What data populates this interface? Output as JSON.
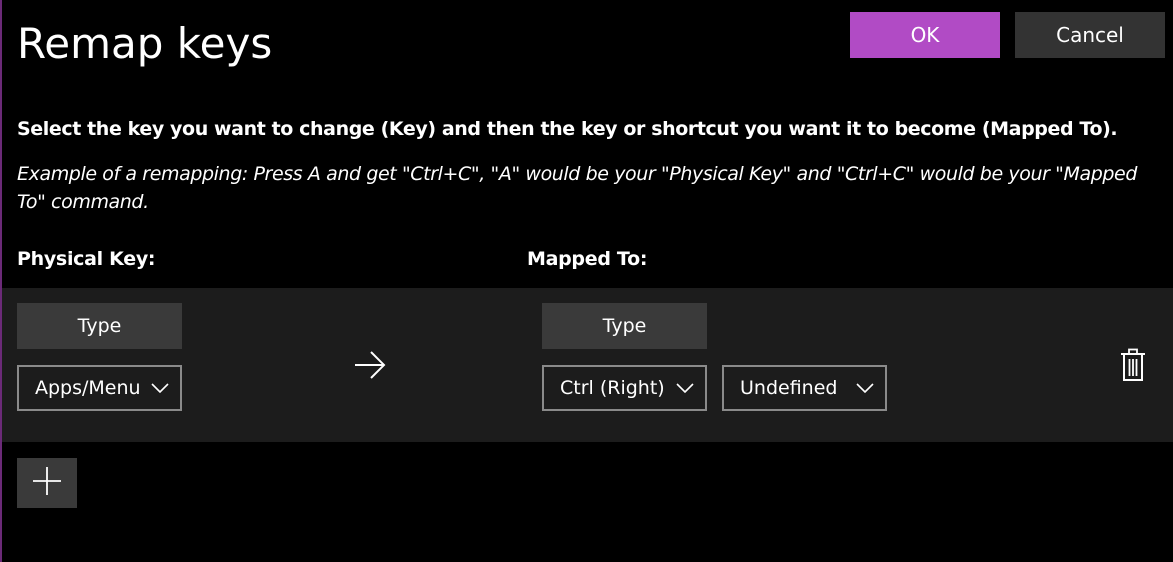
{
  "window": {
    "title": "Remap keys"
  },
  "actions": {
    "ok_label": "OK",
    "cancel_label": "Cancel"
  },
  "colors": {
    "accent": "#b14bc5",
    "background": "#000000",
    "row_background": "#1c1c1c",
    "button_background": "#3a3a3a"
  },
  "description": {
    "instruction": "Select the key you want to change (Key) and then the key or shortcut you want it to become (Mapped To).",
    "example": "Example of a remapping: Press A and get \"Ctrl+C\", \"A\" would be your \"Physical Key\" and \"Ctrl+C\" would be your \"Mapped To\" command."
  },
  "columns": {
    "physical_key": "Physical Key:",
    "mapped_to": "Mapped To:"
  },
  "remap_rows": [
    {
      "physical": {
        "type_label": "Type",
        "selected_key": "Apps/Menu"
      },
      "arrow_icon": "arrow-right-icon",
      "mapped": {
        "type_label": "Type",
        "selected_keys": [
          "Ctrl (Right)",
          "Undefined"
        ]
      },
      "delete_icon": "trash-icon"
    }
  ],
  "add_button_icon": "plus-icon"
}
